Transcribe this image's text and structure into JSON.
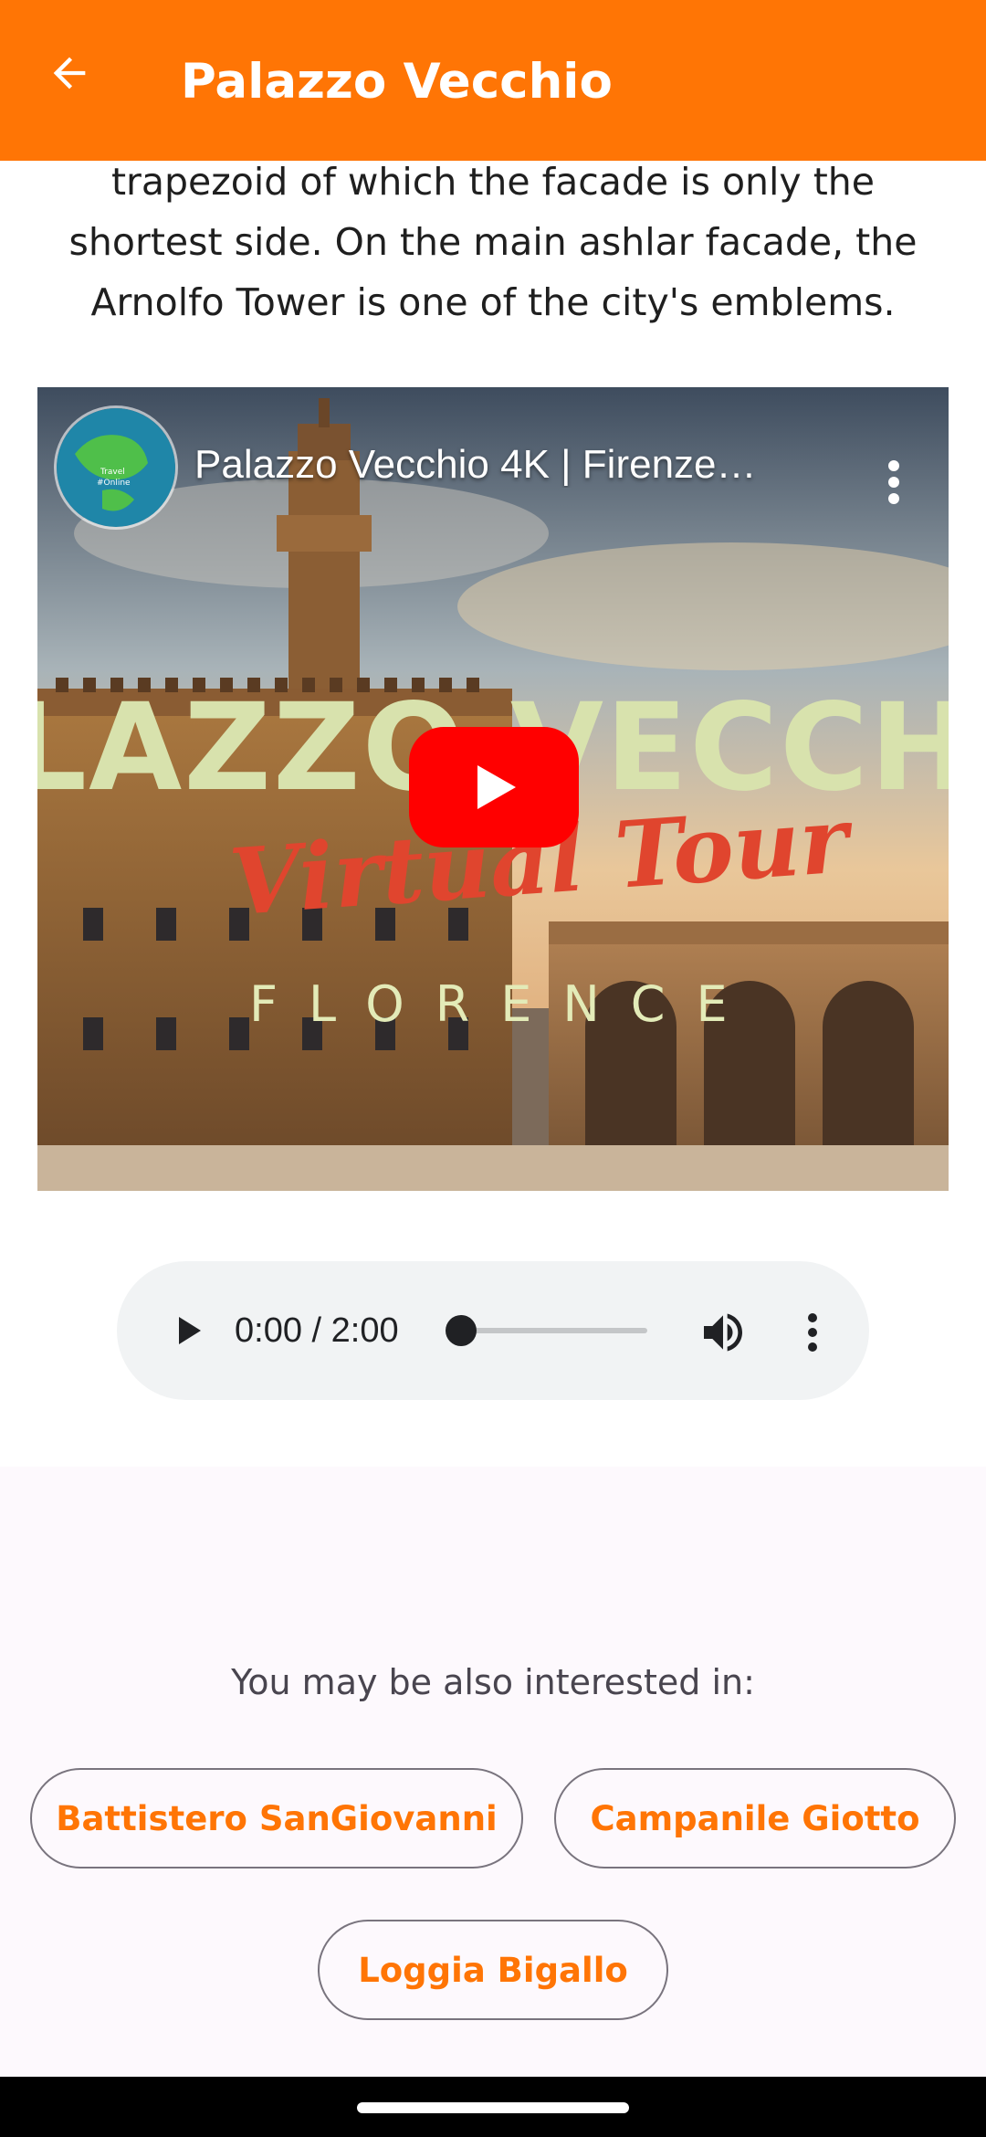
{
  "app_bar": {
    "title": "Palazzo Vecchio",
    "background": "#ff7505",
    "back_icon": "arrow-back-icon"
  },
  "description": {
    "text": "trapezoid of which the facade is only the shortest side. On the main ashlar facade, the Arnolfo Tower is one of the city's emblems."
  },
  "video": {
    "title": "Palazzo Vecchio 4K | Firenze…",
    "thumbnail_title_text": "LAZZO VECCH",
    "thumbnail_subtitle": "Virtual Tour",
    "thumbnail_place": "FLORENCE",
    "play_icon": "youtube-play-icon",
    "menu_icon": "more-vert-icon"
  },
  "audio_player": {
    "time": "0:00 / 2:00",
    "progress": 0,
    "play_icon": "play-icon",
    "volume_icon": "volume-icon",
    "menu_icon": "more-vert-icon"
  },
  "related": {
    "label": "You may be also interested in:",
    "items": [
      {
        "label": "Battistero SanGiovanni"
      },
      {
        "label": "Campanile Giotto"
      },
      {
        "label": "Loggia Bigallo"
      }
    ],
    "accent": "#ff7505"
  }
}
